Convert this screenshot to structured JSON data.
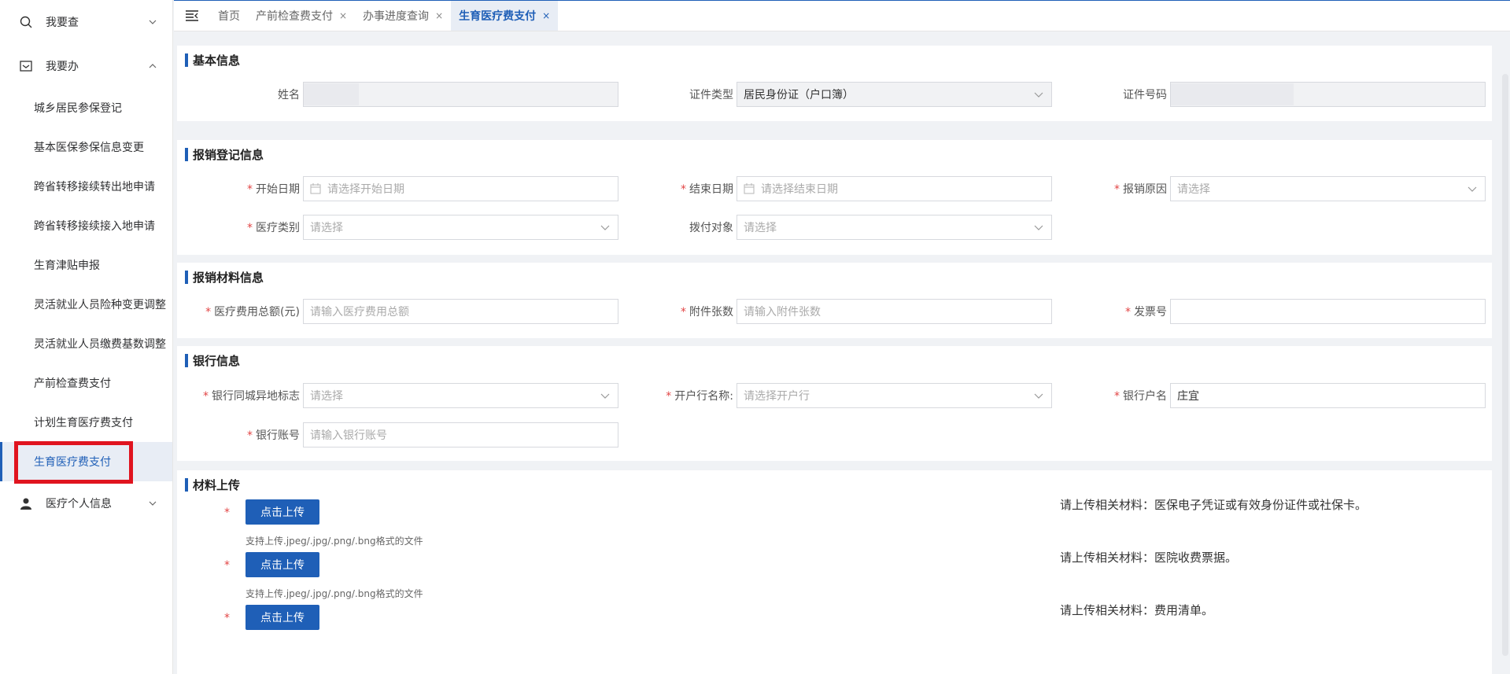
{
  "sidebar": {
    "menu_search": {
      "label": "我要查",
      "icon": "search-icon",
      "expanded": false
    },
    "menu_do": {
      "label": "我要办",
      "icon": "inbox-icon",
      "expanded": true
    },
    "items": [
      {
        "label": "城乡居民参保登记"
      },
      {
        "label": "基本医保参保信息变更"
      },
      {
        "label": "跨省转移接续转出地申请"
      },
      {
        "label": "跨省转移接续接入地申请"
      },
      {
        "label": "生育津贴申报"
      },
      {
        "label": "灵活就业人员险种变更调整"
      },
      {
        "label": "灵活就业人员缴费基数调整"
      },
      {
        "label": "产前检查费支付"
      },
      {
        "label": "计划生育医疗费支付"
      },
      {
        "label": "生育医疗费支付",
        "active": true
      }
    ],
    "menu_personal": {
      "label": "医疗个人信息",
      "icon": "user-icon",
      "expanded": false
    }
  },
  "tabs": [
    {
      "label": "首页",
      "closable": false,
      "active": false
    },
    {
      "label": "产前检查费支付",
      "closable": true,
      "active": false
    },
    {
      "label": "办事进度查询",
      "closable": true,
      "active": false
    },
    {
      "label": "生育医疗费支付",
      "closable": true,
      "active": true
    }
  ],
  "close_glyph": "×",
  "sections": {
    "basic": {
      "title": "基本信息",
      "name_label": "姓名",
      "id_type_label": "证件类型",
      "id_type_value": "居民身份证（户口簿）",
      "id_no_label": "证件号码"
    },
    "claim": {
      "title": "报销登记信息",
      "start_label": "开始日期",
      "start_placeholder": "请选择开始日期",
      "end_label": "结束日期",
      "end_placeholder": "请选择结束日期",
      "reason_label": "报销原因",
      "reason_placeholder": "请选择",
      "category_label": "医疗类别",
      "category_placeholder": "请选择",
      "payee_label": "拨付对象",
      "payee_placeholder": "请选择"
    },
    "materials": {
      "title": "报销材料信息",
      "total_label": "医疗费用总额(元)",
      "total_placeholder": "请输入医疗费用总额",
      "attach_label": "附件张数",
      "attach_placeholder": "请输入附件张数",
      "invoice_label": "发票号",
      "invoice_value": ""
    },
    "bank": {
      "title": "银行信息",
      "flag_label": "银行同城异地标志",
      "flag_placeholder": "请选择",
      "branch_label": "开户行名称:",
      "branch_placeholder": "请选择开户行",
      "holder_label": "银行户名",
      "holder_value": "庄宜",
      "account_label": "银行账号",
      "account_placeholder": "请输入银行账号"
    },
    "upload": {
      "title": "材料上传",
      "button_label": "点击上传",
      "hint": "支持上传.jpeg/.jpg/.png/.bng格式的文件",
      "items": [
        {
          "desc": "请上传相关材料：医保电子凭证或有效身份证件或社保卡。"
        },
        {
          "desc": "请上传相关材料：医院收费票据。"
        },
        {
          "desc": "请上传相关材料：费用清单。"
        }
      ]
    }
  },
  "required_mark": "*",
  "colors": {
    "primary": "#1f5fb7",
    "required": "#e24545",
    "highlight": "#e0141f"
  }
}
